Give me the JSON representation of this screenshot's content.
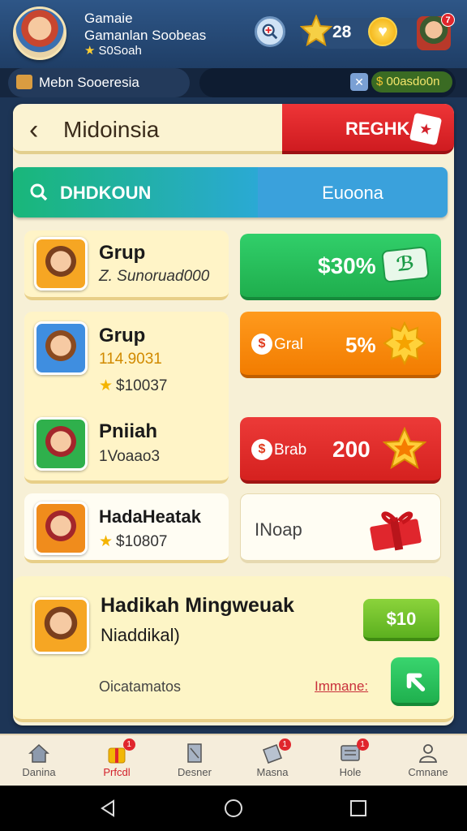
{
  "header": {
    "title": "Gamaie",
    "subtitle": "Gamanlan Soobeas",
    "stat": "S0Soah",
    "star_count": "28",
    "heart_symbol": "♥",
    "notif_count": "7"
  },
  "subbar": {
    "mode_label": "Mebn Sooeresia",
    "coin_value": "00asdo0n"
  },
  "page": {
    "back_symbol": "‹",
    "title": "Midoinsia",
    "reward_label": "REGHK"
  },
  "tabs": {
    "left": "DHDKOUN",
    "right": "Euoona"
  },
  "groups": [
    {
      "title": "Grup",
      "line1": "Z. Sunoruad000",
      "line2": ""
    },
    {
      "title": "Grup",
      "line1": "114.9031",
      "line2": "$10037"
    },
    {
      "title": "Pniiah",
      "line1": "1Voaao3",
      "line2": ""
    },
    {
      "title": "HadaHeatak",
      "line1": "",
      "line2": "$10807"
    }
  ],
  "actions": [
    {
      "value": "$30%",
      "icon": "note-icon"
    },
    {
      "label": "Gral",
      "value": "5%",
      "icon": "sun-badge"
    },
    {
      "label": "Brab",
      "value": "200",
      "icon": "star-badge"
    },
    {
      "label": "INoap",
      "icon": "gift-icon"
    }
  ],
  "bottom": {
    "title": "Hadikah Mingweuak",
    "subtitle": "Niaddikal)",
    "footer": "Oicatamatos",
    "link": "Immane:",
    "claim_label": "$10"
  },
  "nav": [
    {
      "label": "Danina",
      "icon": "home-icon"
    },
    {
      "label": "Prfcdl",
      "icon": "gift-icon",
      "badge": "1"
    },
    {
      "label": "Desner",
      "icon": "book-icon"
    },
    {
      "label": "Masna",
      "icon": "mail-icon",
      "badge": "1"
    },
    {
      "label": "Hole",
      "icon": "list-icon",
      "badge": "1"
    },
    {
      "label": "Cmnane",
      "icon": "people-icon"
    }
  ],
  "colors": {
    "header_blue": "#2e5687",
    "reward_red": "#d2202a",
    "green": "#1fae4d",
    "orange": "#f27c00",
    "panel_cream": "#f7f0d6"
  }
}
